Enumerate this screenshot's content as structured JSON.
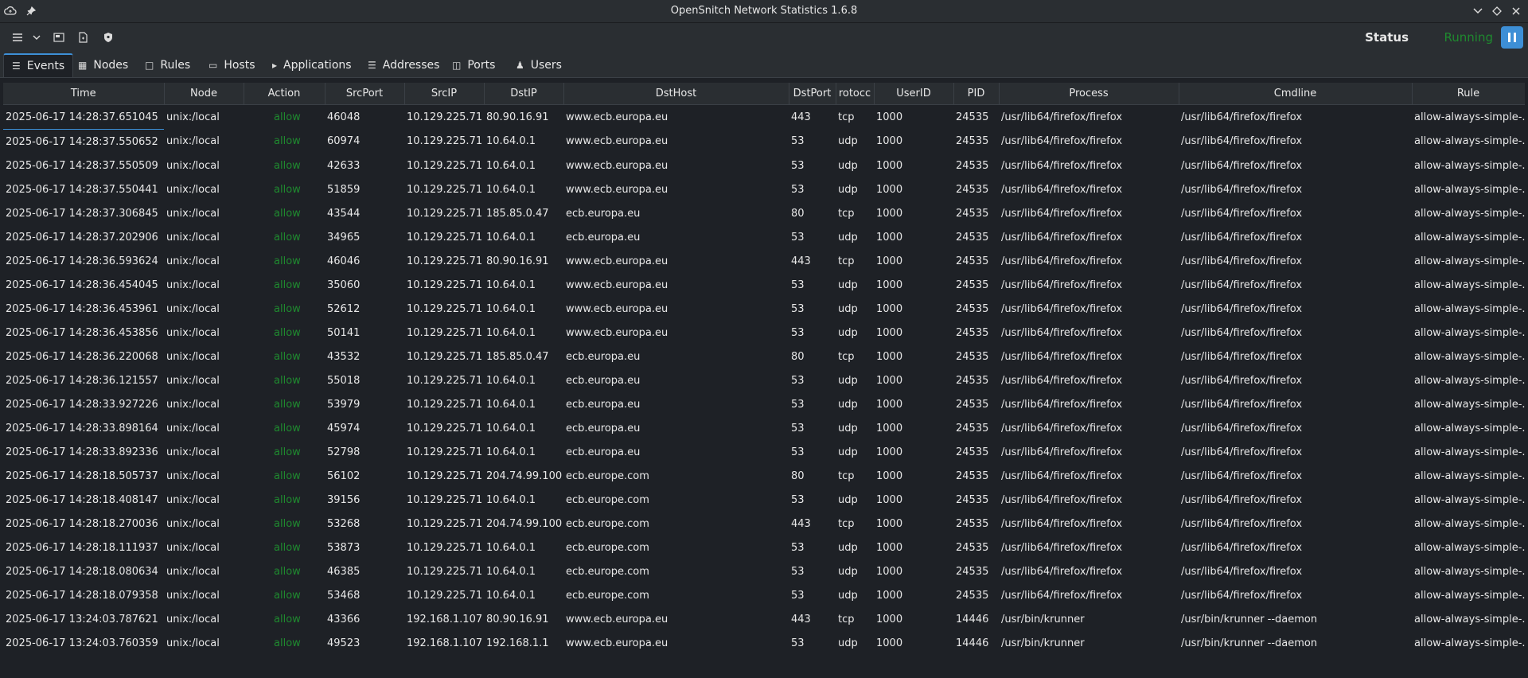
{
  "window": {
    "title": "OpenSnitch Network Statistics 1.6.8"
  },
  "status": {
    "label": "Status",
    "value": "Running"
  },
  "tabs": [
    {
      "label": "Events",
      "icon": "events-icon"
    },
    {
      "label": "Nodes",
      "icon": "nodes-icon"
    },
    {
      "label": "Rules",
      "icon": "rules-icon"
    },
    {
      "label": "Hosts",
      "icon": "hosts-icon"
    },
    {
      "label": "Applications",
      "icon": "applications-icon"
    },
    {
      "label": "Addresses",
      "icon": "addresses-icon"
    },
    {
      "label": "Ports",
      "icon": "ports-icon"
    },
    {
      "label": "Users",
      "icon": "users-icon"
    }
  ],
  "columns": [
    "Time",
    "Node",
    "Action",
    "SrcPort",
    "SrcIP",
    "DstIP",
    "DstHost",
    "DstPort",
    "rotocc",
    "UserID",
    "PID",
    "Process",
    "Cmdline",
    "Rule"
  ],
  "rows": [
    [
      "2025-06-17 14:28:37.651045",
      "unix:/local",
      "allow",
      "46048",
      "10.129.225.71",
      "80.90.16.91",
      "www.ecb.europa.eu",
      "443",
      "tcp",
      "1000",
      "24535",
      "/usr/lib64/firefox/firefox",
      "/usr/lib64/firefox/firefox",
      "allow-always-simple-..."
    ],
    [
      "2025-06-17 14:28:37.550652",
      "unix:/local",
      "allow",
      "60974",
      "10.129.225.71",
      "10.64.0.1",
      "www.ecb.europa.eu",
      "53",
      "udp",
      "1000",
      "24535",
      "/usr/lib64/firefox/firefox",
      "/usr/lib64/firefox/firefox",
      "allow-always-simple-..."
    ],
    [
      "2025-06-17 14:28:37.550509",
      "unix:/local",
      "allow",
      "42633",
      "10.129.225.71",
      "10.64.0.1",
      "www.ecb.europa.eu",
      "53",
      "udp",
      "1000",
      "24535",
      "/usr/lib64/firefox/firefox",
      "/usr/lib64/firefox/firefox",
      "allow-always-simple-..."
    ],
    [
      "2025-06-17 14:28:37.550441",
      "unix:/local",
      "allow",
      "51859",
      "10.129.225.71",
      "10.64.0.1",
      "www.ecb.europa.eu",
      "53",
      "udp",
      "1000",
      "24535",
      "/usr/lib64/firefox/firefox",
      "/usr/lib64/firefox/firefox",
      "allow-always-simple-..."
    ],
    [
      "2025-06-17 14:28:37.306845",
      "unix:/local",
      "allow",
      "43544",
      "10.129.225.71",
      "185.85.0.47",
      "ecb.europa.eu",
      "80",
      "tcp",
      "1000",
      "24535",
      "/usr/lib64/firefox/firefox",
      "/usr/lib64/firefox/firefox",
      "allow-always-simple-..."
    ],
    [
      "2025-06-17 14:28:37.202906",
      "unix:/local",
      "allow",
      "34965",
      "10.129.225.71",
      "10.64.0.1",
      "ecb.europa.eu",
      "53",
      "udp",
      "1000",
      "24535",
      "/usr/lib64/firefox/firefox",
      "/usr/lib64/firefox/firefox",
      "allow-always-simple-..."
    ],
    [
      "2025-06-17 14:28:36.593624",
      "unix:/local",
      "allow",
      "46046",
      "10.129.225.71",
      "80.90.16.91",
      "www.ecb.europa.eu",
      "443",
      "tcp",
      "1000",
      "24535",
      "/usr/lib64/firefox/firefox",
      "/usr/lib64/firefox/firefox",
      "allow-always-simple-..."
    ],
    [
      "2025-06-17 14:28:36.454045",
      "unix:/local",
      "allow",
      "35060",
      "10.129.225.71",
      "10.64.0.1",
      "www.ecb.europa.eu",
      "53",
      "udp",
      "1000",
      "24535",
      "/usr/lib64/firefox/firefox",
      "/usr/lib64/firefox/firefox",
      "allow-always-simple-..."
    ],
    [
      "2025-06-17 14:28:36.453961",
      "unix:/local",
      "allow",
      "52612",
      "10.129.225.71",
      "10.64.0.1",
      "www.ecb.europa.eu",
      "53",
      "udp",
      "1000",
      "24535",
      "/usr/lib64/firefox/firefox",
      "/usr/lib64/firefox/firefox",
      "allow-always-simple-..."
    ],
    [
      "2025-06-17 14:28:36.453856",
      "unix:/local",
      "allow",
      "50141",
      "10.129.225.71",
      "10.64.0.1",
      "www.ecb.europa.eu",
      "53",
      "udp",
      "1000",
      "24535",
      "/usr/lib64/firefox/firefox",
      "/usr/lib64/firefox/firefox",
      "allow-always-simple-..."
    ],
    [
      "2025-06-17 14:28:36.220068",
      "unix:/local",
      "allow",
      "43532",
      "10.129.225.71",
      "185.85.0.47",
      "ecb.europa.eu",
      "80",
      "tcp",
      "1000",
      "24535",
      "/usr/lib64/firefox/firefox",
      "/usr/lib64/firefox/firefox",
      "allow-always-simple-..."
    ],
    [
      "2025-06-17 14:28:36.121557",
      "unix:/local",
      "allow",
      "55018",
      "10.129.225.71",
      "10.64.0.1",
      "ecb.europa.eu",
      "53",
      "udp",
      "1000",
      "24535",
      "/usr/lib64/firefox/firefox",
      "/usr/lib64/firefox/firefox",
      "allow-always-simple-..."
    ],
    [
      "2025-06-17 14:28:33.927226",
      "unix:/local",
      "allow",
      "53979",
      "10.129.225.71",
      "10.64.0.1",
      "ecb.europa.eu",
      "53",
      "udp",
      "1000",
      "24535",
      "/usr/lib64/firefox/firefox",
      "/usr/lib64/firefox/firefox",
      "allow-always-simple-..."
    ],
    [
      "2025-06-17 14:28:33.898164",
      "unix:/local",
      "allow",
      "45974",
      "10.129.225.71",
      "10.64.0.1",
      "ecb.europa.eu",
      "53",
      "udp",
      "1000",
      "24535",
      "/usr/lib64/firefox/firefox",
      "/usr/lib64/firefox/firefox",
      "allow-always-simple-..."
    ],
    [
      "2025-06-17 14:28:33.892336",
      "unix:/local",
      "allow",
      "52798",
      "10.129.225.71",
      "10.64.0.1",
      "ecb.europa.eu",
      "53",
      "udp",
      "1000",
      "24535",
      "/usr/lib64/firefox/firefox",
      "/usr/lib64/firefox/firefox",
      "allow-always-simple-..."
    ],
    [
      "2025-06-17 14:28:18.505737",
      "unix:/local",
      "allow",
      "56102",
      "10.129.225.71",
      "204.74.99.100",
      "ecb.europe.com",
      "80",
      "tcp",
      "1000",
      "24535",
      "/usr/lib64/firefox/firefox",
      "/usr/lib64/firefox/firefox",
      "allow-always-simple-..."
    ],
    [
      "2025-06-17 14:28:18.408147",
      "unix:/local",
      "allow",
      "39156",
      "10.129.225.71",
      "10.64.0.1",
      "ecb.europe.com",
      "53",
      "udp",
      "1000",
      "24535",
      "/usr/lib64/firefox/firefox",
      "/usr/lib64/firefox/firefox",
      "allow-always-simple-..."
    ],
    [
      "2025-06-17 14:28:18.270036",
      "unix:/local",
      "allow",
      "53268",
      "10.129.225.71",
      "204.74.99.100",
      "ecb.europe.com",
      "443",
      "tcp",
      "1000",
      "24535",
      "/usr/lib64/firefox/firefox",
      "/usr/lib64/firefox/firefox",
      "allow-always-simple-..."
    ],
    [
      "2025-06-17 14:28:18.111937",
      "unix:/local",
      "allow",
      "53873",
      "10.129.225.71",
      "10.64.0.1",
      "ecb.europe.com",
      "53",
      "udp",
      "1000",
      "24535",
      "/usr/lib64/firefox/firefox",
      "/usr/lib64/firefox/firefox",
      "allow-always-simple-..."
    ],
    [
      "2025-06-17 14:28:18.080634",
      "unix:/local",
      "allow",
      "46385",
      "10.129.225.71",
      "10.64.0.1",
      "ecb.europe.com",
      "53",
      "udp",
      "1000",
      "24535",
      "/usr/lib64/firefox/firefox",
      "/usr/lib64/firefox/firefox",
      "allow-always-simple-..."
    ],
    [
      "2025-06-17 14:28:18.079358",
      "unix:/local",
      "allow",
      "53468",
      "10.129.225.71",
      "10.64.0.1",
      "ecb.europe.com",
      "53",
      "udp",
      "1000",
      "24535",
      "/usr/lib64/firefox/firefox",
      "/usr/lib64/firefox/firefox",
      "allow-always-simple-..."
    ],
    [
      "2025-06-17 13:24:03.787621",
      "unix:/local",
      "allow",
      "43366",
      "192.168.1.107",
      "80.90.16.91",
      "www.ecb.europa.eu",
      "443",
      "tcp",
      "1000",
      "14446",
      "/usr/bin/krunner",
      "/usr/bin/krunner --daemon",
      "allow-always-simple-..."
    ],
    [
      "2025-06-17 13:24:03.760359",
      "unix:/local",
      "allow",
      "49523",
      "192.168.1.107",
      "192.168.1.1",
      "www.ecb.europa.eu",
      "53",
      "udp",
      "1000",
      "14446",
      "/usr/bin/krunner",
      "/usr/bin/krunner --daemon",
      "allow-always-simple-..."
    ]
  ],
  "colors": {
    "allow": "#1f8a2f",
    "accent": "#3d8fd6",
    "background": "#1e2126"
  }
}
